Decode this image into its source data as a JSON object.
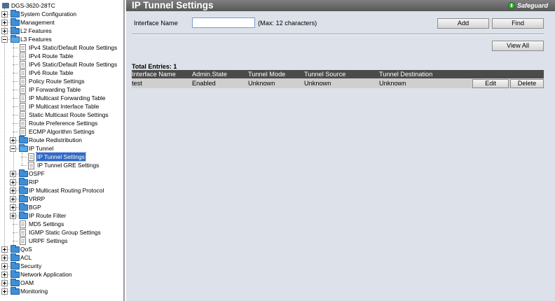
{
  "tree": {
    "root": "DGS-3620-28TC",
    "items": [
      "System Configuration",
      "Management",
      "L2 Features",
      "L3 Features",
      "IPv4 Static/Default Route Settings",
      "IPv4 Route Table",
      "IPv6 Static/Default Route Settings",
      "IPv6 Route Table",
      "Policy Route Settings",
      "IP Forwarding Table",
      "IP Multicast Forwarding Table",
      "IP Multicast Interface Table",
      "Static Multicast Route Settings",
      "Route Preference Settings",
      "ECMP Algorithm Settings",
      "Route Redistribution",
      "IP Tunnel",
      "IP Tunnel Settings",
      "IP Tunnel GRE Settings",
      "OSPF",
      "RIP",
      "IP Multicast Routing Protocol",
      "VRRP",
      "BGP",
      "IP Route Filter",
      "MD5 Settings",
      "IGMP Static Group Settings",
      "URPF Settings",
      "QoS",
      "ACL",
      "Security",
      "Network Application",
      "OAM",
      "Monitoring"
    ]
  },
  "header": {
    "title": "IP Tunnel Settings",
    "badge": "Safeguard"
  },
  "form": {
    "interface_label": "Interface Name",
    "interface_value": "",
    "interface_hint": "(Max: 12 characters)",
    "add_label": "Add",
    "find_label": "Find",
    "view_all_label": "View All"
  },
  "table": {
    "total": "Total Entries: 1",
    "columns": [
      "Interface Name",
      "Admin.State",
      "Tunnel Mode",
      "Tunnel Source",
      "Tunnel Destination"
    ],
    "rows": [
      {
        "interface": "test",
        "admin_state": "Enabled",
        "mode": "Unknown",
        "source": "Unknown",
        "destination": "Unknown"
      }
    ],
    "edit_label": "Edit",
    "delete_label": "Delete"
  },
  "colors": {
    "title_bar": "#575757",
    "table_header": "#4b4b4b",
    "row": "#cfcfcf",
    "main_bg": "#dde1e9",
    "selected": "#316ac5"
  }
}
